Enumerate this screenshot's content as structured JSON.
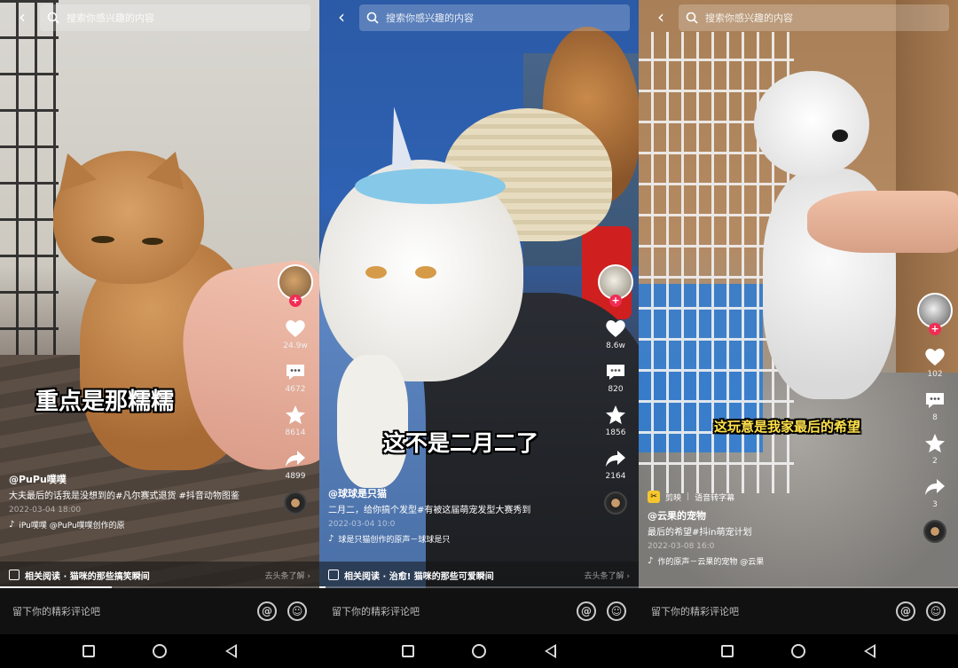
{
  "panels": [
    {
      "search": {
        "placeholder": "搜索你感兴趣的内容"
      },
      "caption": "重点是那糯糯",
      "rail": {
        "likes": "24.9w",
        "comments": "4672",
        "favorites": "8614",
        "shares": "4899"
      },
      "author": "@PuPu噗噗",
      "description": "大夫最后的话我是没想到的#凡尔赛式退货 #抖音动物图鉴",
      "date": "2022-03-04 18:00",
      "music": "iPu噗噗  @PuPu噗噗创作的原",
      "related_title": "相关阅读 · 猫咪的那些搞笑瞬间",
      "related_link": "去头条了解 ›",
      "comment_placeholder": "留下你的精彩评论吧",
      "progress": 0.35
    },
    {
      "search": {
        "placeholder": "搜索你感兴趣的内容"
      },
      "caption": "这不是二月二了",
      "rail": {
        "likes": "8.6w",
        "comments": "820",
        "favorites": "1856",
        "shares": "2164"
      },
      "author": "@球球是只猫",
      "description": "二月二，给你搞个发型#有被这届萌宠发型大赛秀到",
      "date": "2022-03-04 10:0",
      "music": "球是只猫创作的原声－球球是只",
      "related_title": "相关阅读 · 治愈! 猫咪的那些可爱瞬间",
      "related_link": "去头条了解 ›",
      "comment_placeholder": "留下你的精彩评论吧",
      "progress": 0.02
    },
    {
      "search": {
        "placeholder": "搜索你感兴趣的内容"
      },
      "caption": "这玩意是我家最后的希望",
      "edit": {
        "app": "剪映",
        "feature": "语音转字幕"
      },
      "rail": {
        "likes": "102",
        "comments": "8",
        "favorites": "2",
        "shares": "3"
      },
      "author": "@云果的宠物",
      "description": "最后的希望#抖in萌宠计划",
      "date": "2022-03-08 16:0",
      "music": "作的原声－云果的宠物  @云果",
      "comment_placeholder": "留下你的精彩评论吧",
      "progress": 0.0
    }
  ],
  "colors": {
    "accent": "#f12c55",
    "caption_yellow": "#ffe14a",
    "edit_badge": "#f6c72d"
  }
}
